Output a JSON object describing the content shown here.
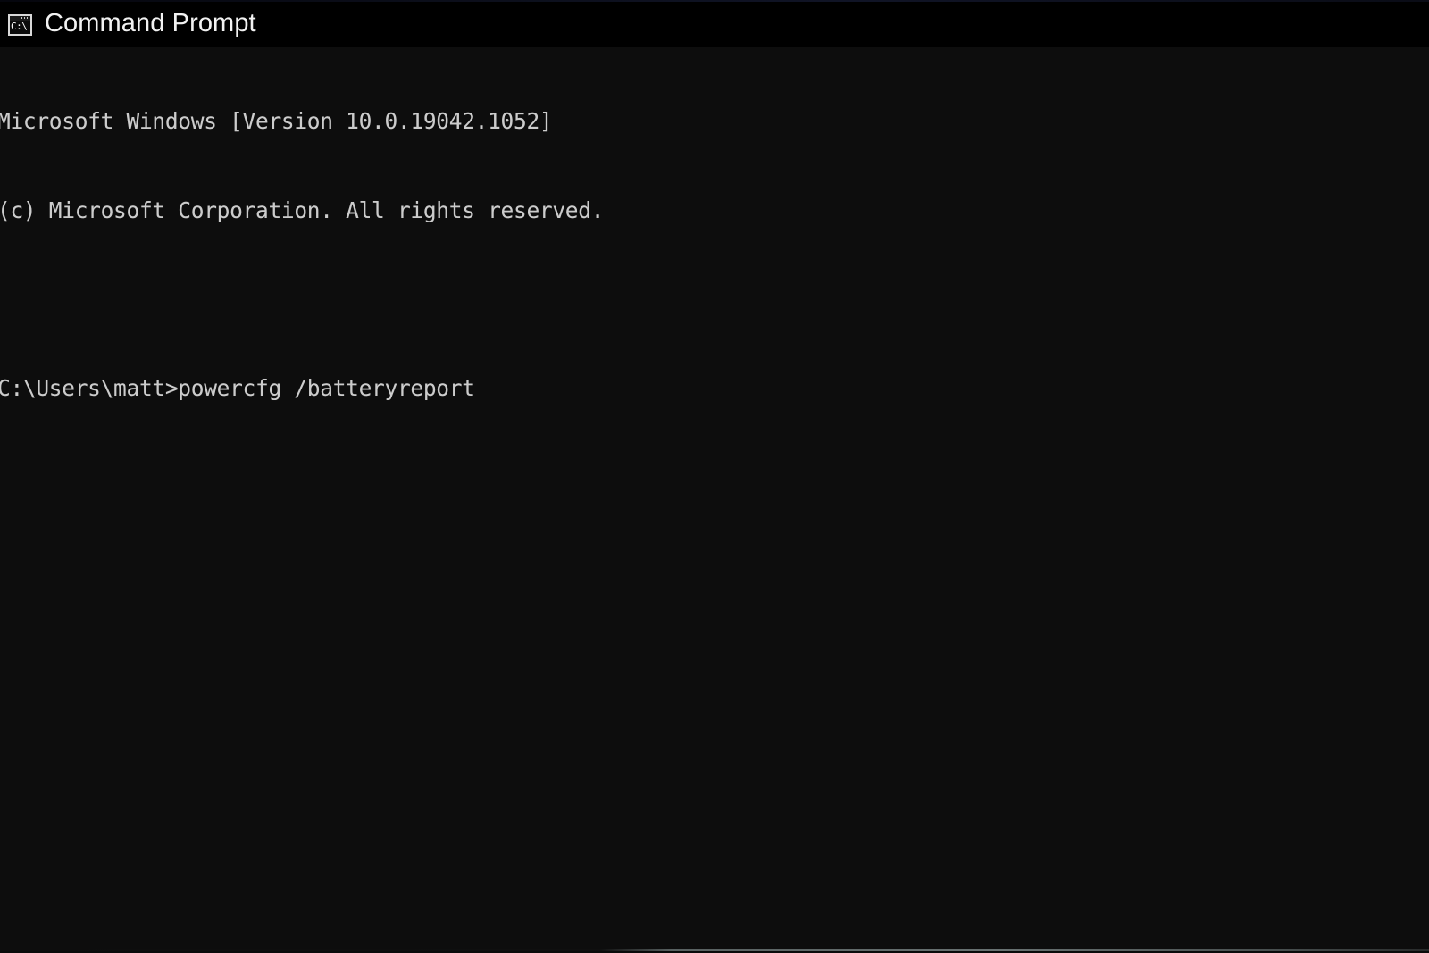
{
  "window": {
    "title": "Command Prompt",
    "icon_name": "command-prompt-icon",
    "icon_glyph": "C:\\.",
    "titlebar_background": "#000000",
    "console_background": "#0d0d0d",
    "console_foreground": "#cccccc"
  },
  "console": {
    "lines": [
      "Microsoft Windows [Version 10.0.19042.1052]",
      "(c) Microsoft Corporation. All rights reserved.",
      "",
      "C:\\Users\\matt>powercfg /batteryreport"
    ],
    "banner_version_line": "Microsoft Windows [Version 10.0.19042.1052]",
    "banner_copyright_line": "(c) Microsoft Corporation. All rights reserved.",
    "prompt": "C:\\Users\\matt>",
    "command": "powercfg /batteryreport",
    "prompt_line": "C:\\Users\\matt>powercfg /batteryreport",
    "os_version": "10.0.19042.1052",
    "user": "matt"
  }
}
